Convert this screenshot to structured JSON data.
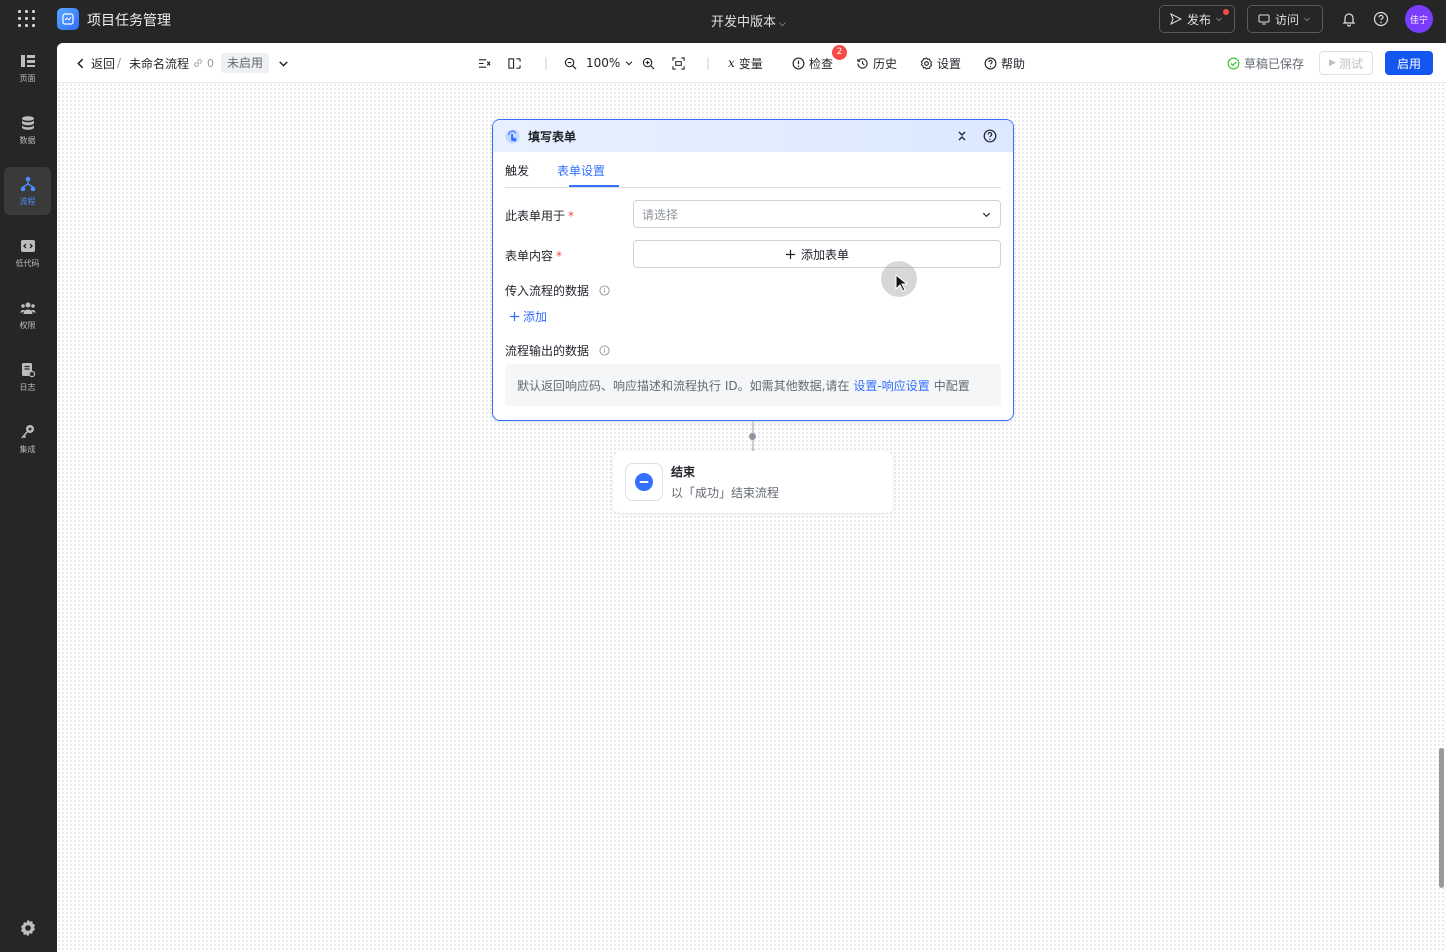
{
  "topbar": {
    "app_title": "项目任务管理",
    "version_label": "开发中版本",
    "publish_label": "发布",
    "visit_label": "访问",
    "avatar_text": "佳宁"
  },
  "sidebar": {
    "items": [
      {
        "label": "页面",
        "icon": "page-icon"
      },
      {
        "label": "数据",
        "icon": "database-icon"
      },
      {
        "label": "流程",
        "icon": "flow-icon",
        "active": true
      },
      {
        "label": "低代码",
        "icon": "code-icon"
      },
      {
        "label": "权限",
        "icon": "users-icon"
      },
      {
        "label": "日志",
        "icon": "log-icon"
      },
      {
        "label": "集成",
        "icon": "integration-icon"
      }
    ]
  },
  "toolbar": {
    "back_label": "返回",
    "separator": "/",
    "flow_name": "未命名流程",
    "link_count": "0",
    "status": "未启用",
    "zoom": "100%",
    "variables_label": "变量",
    "check_label": "检查",
    "check_badge": "2",
    "history_label": "历史",
    "settings_label": "设置",
    "help_label": "帮助",
    "saved_label": "草稿已保存",
    "test_label": "测试",
    "enable_label": "启用"
  },
  "node": {
    "title": "填写表单",
    "tabs": [
      "触发",
      "表单设置"
    ],
    "active_tab": "表单设置",
    "form_for_label": "此表单用于",
    "form_for_placeholder": "请选择",
    "form_content_label": "表单内容",
    "add_form_label": "添加表单",
    "input_data_label": "传入流程的数据",
    "add_label": "添加",
    "output_data_label": "流程输出的数据",
    "output_desc_before": "默认返回响应码、响应描述和流程执行 ID。如需其他数据,请在",
    "output_desc_link": "设置-响应设置",
    "output_desc_after": "中配置",
    "required_mark": "*"
  },
  "end_node": {
    "title": "结束",
    "subtitle": "以「成功」结束流程"
  },
  "colors": {
    "accent": "#3370ff",
    "primary_button": "#1456f0",
    "badge": "#f54a45",
    "active_nav": "#4e8dff"
  }
}
